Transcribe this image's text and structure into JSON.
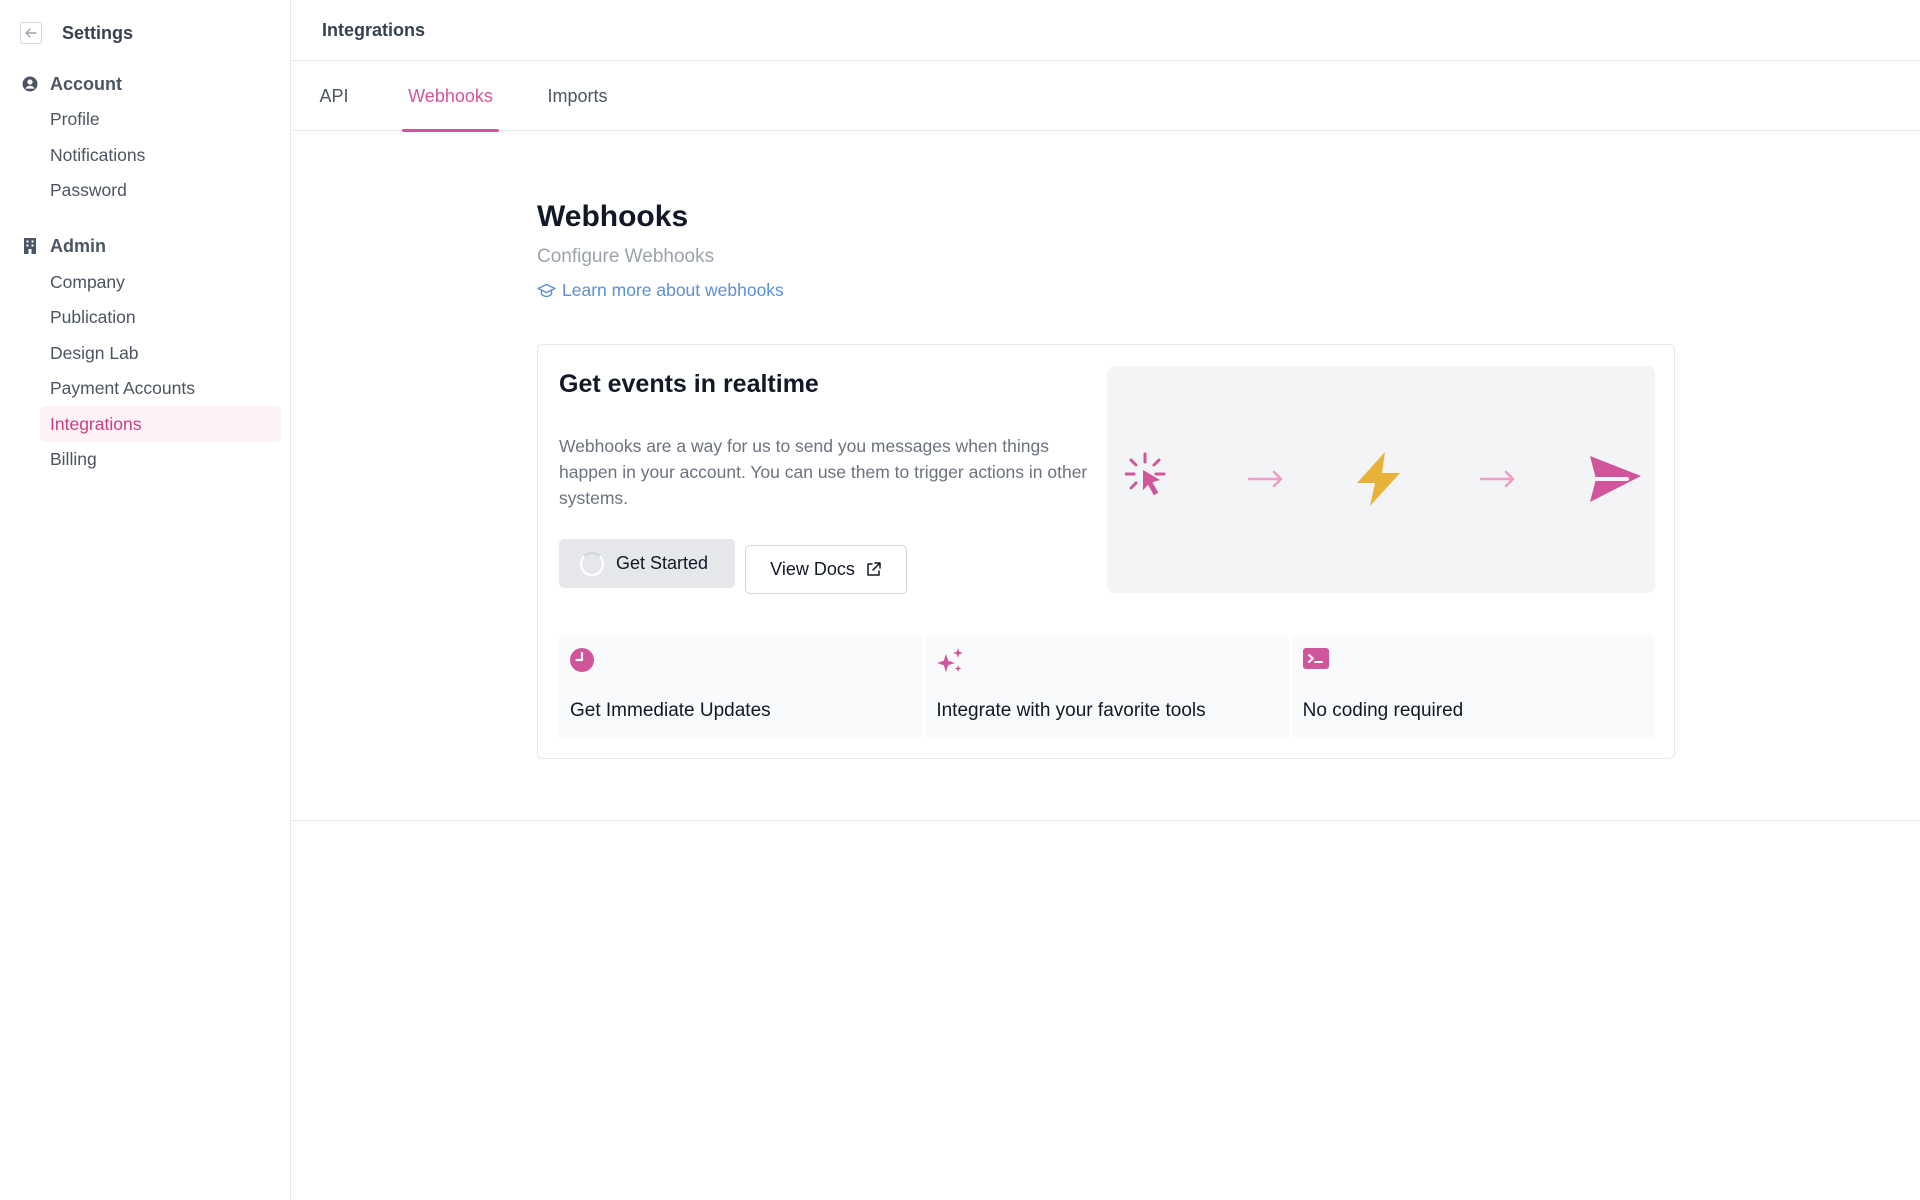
{
  "sidebar": {
    "title": "Settings",
    "sections": [
      {
        "label": "Account",
        "icon": "user-circle-icon",
        "items": [
          "Profile",
          "Notifications",
          "Password"
        ]
      },
      {
        "label": "Admin",
        "icon": "building-icon",
        "items": [
          "Company",
          "Publication",
          "Design Lab",
          "Payment Accounts",
          "Integrations",
          "Billing"
        ]
      }
    ],
    "active_item": "Integrations"
  },
  "topbar": {
    "title": "Integrations"
  },
  "tabs": [
    {
      "label": "API"
    },
    {
      "label": "Webhooks",
      "active": true
    },
    {
      "label": "Imports"
    }
  ],
  "page": {
    "title": "Webhooks",
    "subtitle": "Configure Webhooks",
    "learn_link": "Learn more about webhooks"
  },
  "card": {
    "title": "Get events in realtime",
    "description": "Webhooks are a way for us to send you messages when things happen in your account. You can use them to trigger actions in other systems.",
    "start_button": "Get Started",
    "docs_button": "View Docs",
    "illustration_icons": [
      "click-icon",
      "arrow-right-icon",
      "bolt-icon",
      "arrow-right-icon",
      "send-icon"
    ]
  },
  "features": [
    {
      "icon": "clock-icon",
      "label": "Get Immediate Updates"
    },
    {
      "icon": "sparkles-icon",
      "label": "Integrate with your favorite tools"
    },
    {
      "icon": "terminal-icon",
      "label": "No coding required"
    }
  ],
  "colors": {
    "accent": "#d1559a",
    "link": "#5b8fd8",
    "bolt": "#e8b13a",
    "active_bg": "#fdf2f6"
  }
}
